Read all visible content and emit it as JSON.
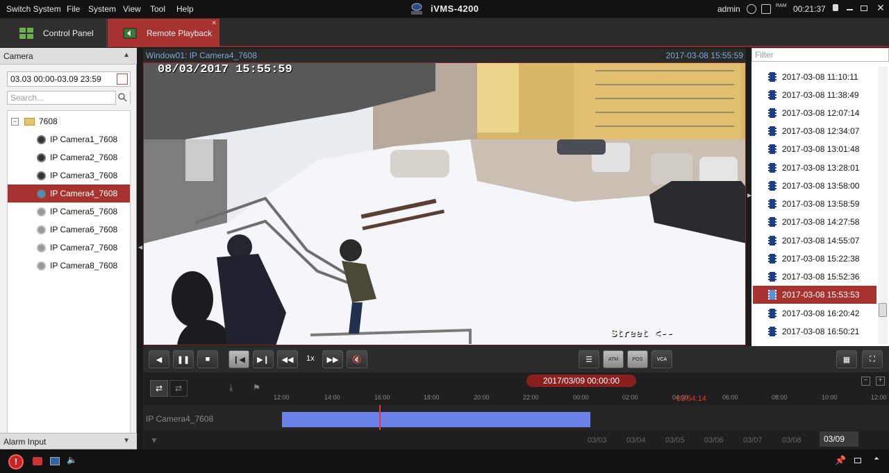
{
  "menu": {
    "items": [
      "Switch System",
      "File",
      "System",
      "View",
      "Tool",
      "Help"
    ],
    "app_title": "iVMS-4200",
    "user": "admin",
    "clock": "00:21:37",
    "ram_label": "RAM"
  },
  "tabs": {
    "control_panel": "Control Panel",
    "remote_playback": "Remote Playback"
  },
  "left_panel": {
    "camera_header": "Camera",
    "date_range": "03.03 00:00-03.09 23:59",
    "search_placeholder": "Search...",
    "folder": "7608",
    "cameras": [
      "IP Camera1_7608",
      "IP Camera2_7608",
      "IP Camera3_7608",
      "IP Camera4_7608",
      "IP Camera5_7608",
      "IP Camera6_7608",
      "IP Camera7_7608",
      "IP Camera8_7608"
    ],
    "selected_camera": "IP Camera4_7608",
    "alarm_header": "Alarm Input"
  },
  "video": {
    "window_label": "Window01:  IP Camera4_7608",
    "timestamp": "2017-03-08 15:55:59",
    "overlay_time": "08/03/2017 15:55:59",
    "overlay_street": "Street <--"
  },
  "file_list": {
    "filter_placeholder": "Filter",
    "files": [
      "2017-03-08 11:10:11",
      "2017-03-08 11:38:49",
      "2017-03-08 12:07:14",
      "2017-03-08 12:34:07",
      "2017-03-08 13:01:48",
      "2017-03-08 13:28:01",
      "2017-03-08 13:58:00",
      "2017-03-08 13:58:59",
      "2017-03-08 14:27:58",
      "2017-03-08 14:55:07",
      "2017-03-08 15:22:38",
      "2017-03-08 15:52:36",
      "2017-03-08 15:53:53",
      "2017-03-08 16:20:42",
      "2017-03-08 16:50:21"
    ],
    "selected_file": "2017-03-08 15:53:53"
  },
  "controls": {
    "speed": "1x",
    "atm_label": "ATM",
    "pos_label": "POS",
    "vca_label": "VCA"
  },
  "timeline": {
    "current_date": "2017/03/09 00:00:00",
    "ticks": [
      "12:00",
      "14:00",
      "16:00",
      "18:00",
      "20:00",
      "22:00",
      "00:00",
      "02:00",
      "04:00",
      "06:00",
      "08:00",
      "10:00",
      "12:00"
    ],
    "cursor_time": "03:54:14",
    "track_label": "IP Camera4_7608",
    "days": [
      "03/03",
      "03/04",
      "03/05",
      "03/06",
      "03/07",
      "03/08"
    ],
    "active_day": "03/09",
    "recording_fraction": 0.41
  }
}
